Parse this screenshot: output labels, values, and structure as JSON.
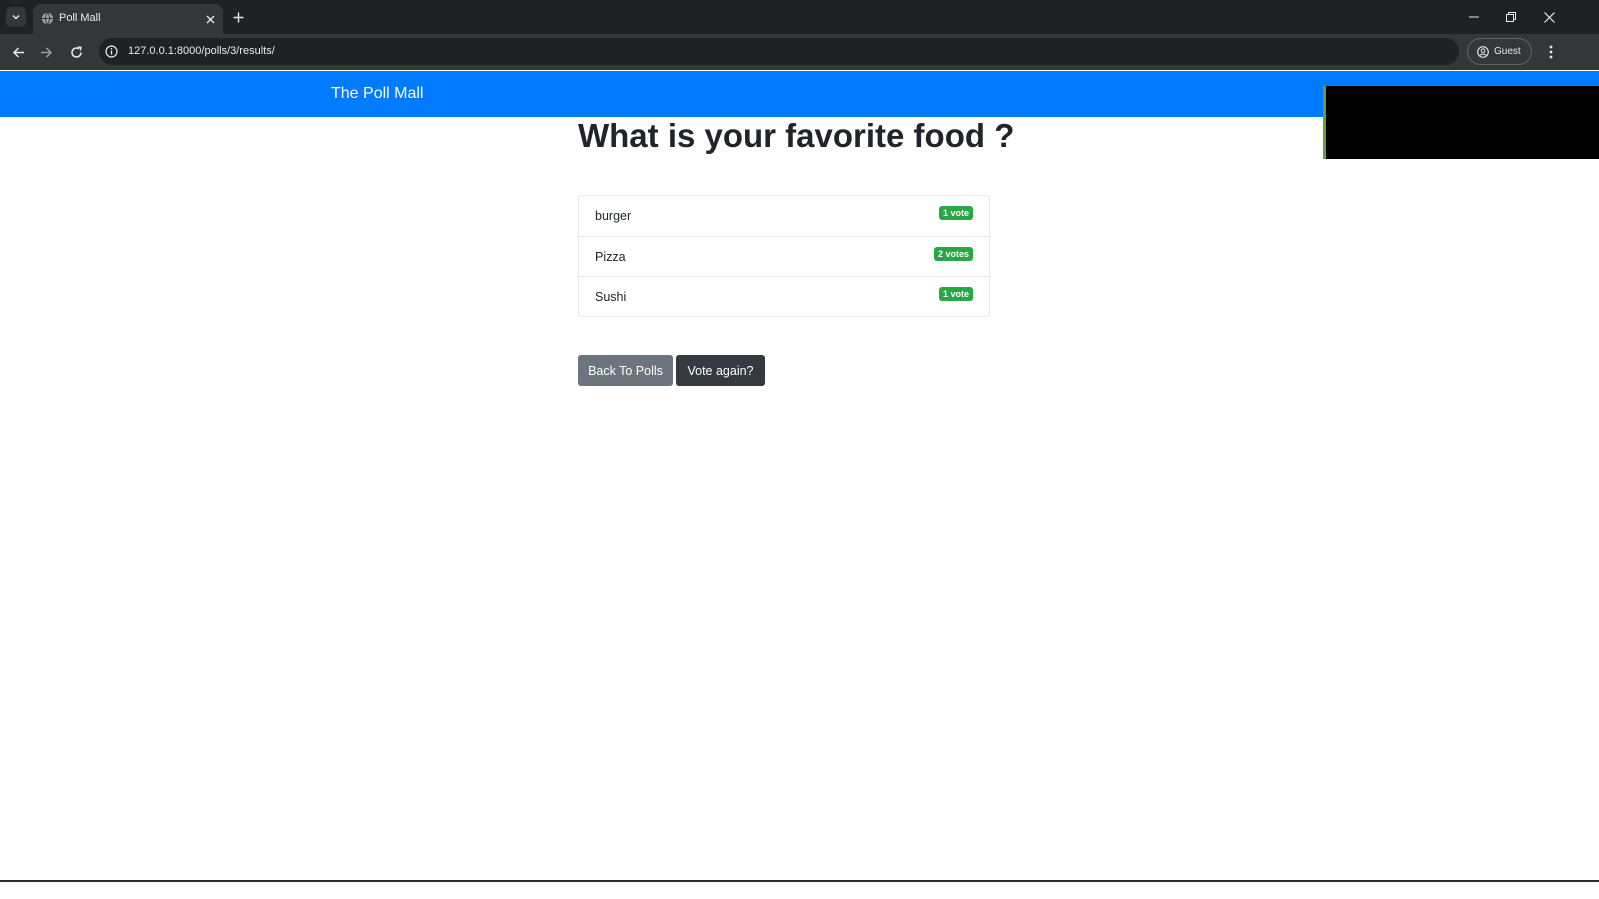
{
  "browser": {
    "tab_title": "Poll Mall",
    "url": "127.0.0.1:8000/polls/3/results/",
    "profile_label": "Guest"
  },
  "page": {
    "brand": "The Poll Mall",
    "question": "What is your favorite food ?",
    "choices": [
      {
        "text": "burger",
        "votes": "1 vote"
      },
      {
        "text": "Pizza",
        "votes": "2 votes"
      },
      {
        "text": "Sushi",
        "votes": "1 vote"
      }
    ],
    "buttons": {
      "back": "Back To Polls",
      "vote_again": "Vote again?"
    }
  },
  "colors": {
    "navbar": "#007bff",
    "badge": "#28a745",
    "btn_secondary": "#6c757d",
    "btn_dark": "#343a40"
  }
}
